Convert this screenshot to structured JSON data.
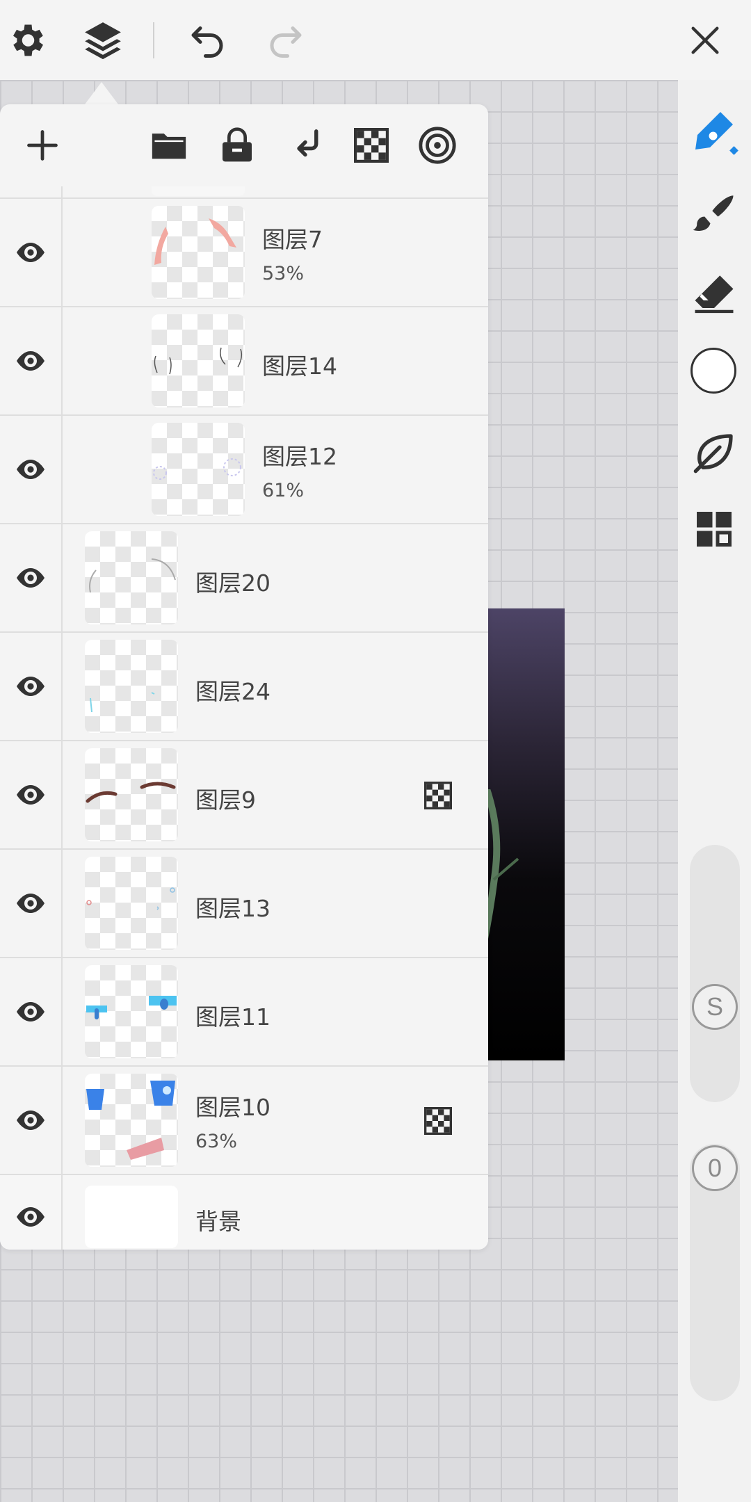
{
  "toolbar": {
    "icons": [
      "gear-icon",
      "layers-icon",
      "undo-icon",
      "redo-icon",
      "close-icon"
    ]
  },
  "layer_panel": {
    "tools": [
      "add-icon",
      "folder-icon",
      "lock-icon",
      "merge-down-icon",
      "checker-icon",
      "target-icon"
    ],
    "layers": [
      {
        "name": "图层7",
        "opacity": "53%",
        "visible": true
      },
      {
        "name": "图层14",
        "opacity": "",
        "visible": true
      },
      {
        "name": "图层12",
        "opacity": "61%",
        "visible": true
      },
      {
        "name": "图层20",
        "opacity": "",
        "visible": true
      },
      {
        "name": "图层24",
        "opacity": "",
        "visible": true
      },
      {
        "name": "图层9",
        "opacity": "",
        "visible": true,
        "clipping": true
      },
      {
        "name": "图层13",
        "opacity": "",
        "visible": true
      },
      {
        "name": "图层11",
        "opacity": "",
        "visible": true
      },
      {
        "name": "图层10",
        "opacity": "63%",
        "visible": true,
        "clipping": true
      },
      {
        "name": "背景",
        "opacity": "",
        "visible": true
      }
    ]
  },
  "right_rail": {
    "tools": [
      "pen-icon",
      "brush-icon",
      "eraser-icon",
      "color-picker",
      "leaf-icon",
      "grid-menu-icon"
    ],
    "size_slider": {
      "label": "S"
    },
    "opacity_slider": {
      "label": "0"
    }
  },
  "colors": {
    "accent": "#1e88e5",
    "panel_bg": "#f4f4f4",
    "canvas_bg": "#dcdcdf"
  }
}
